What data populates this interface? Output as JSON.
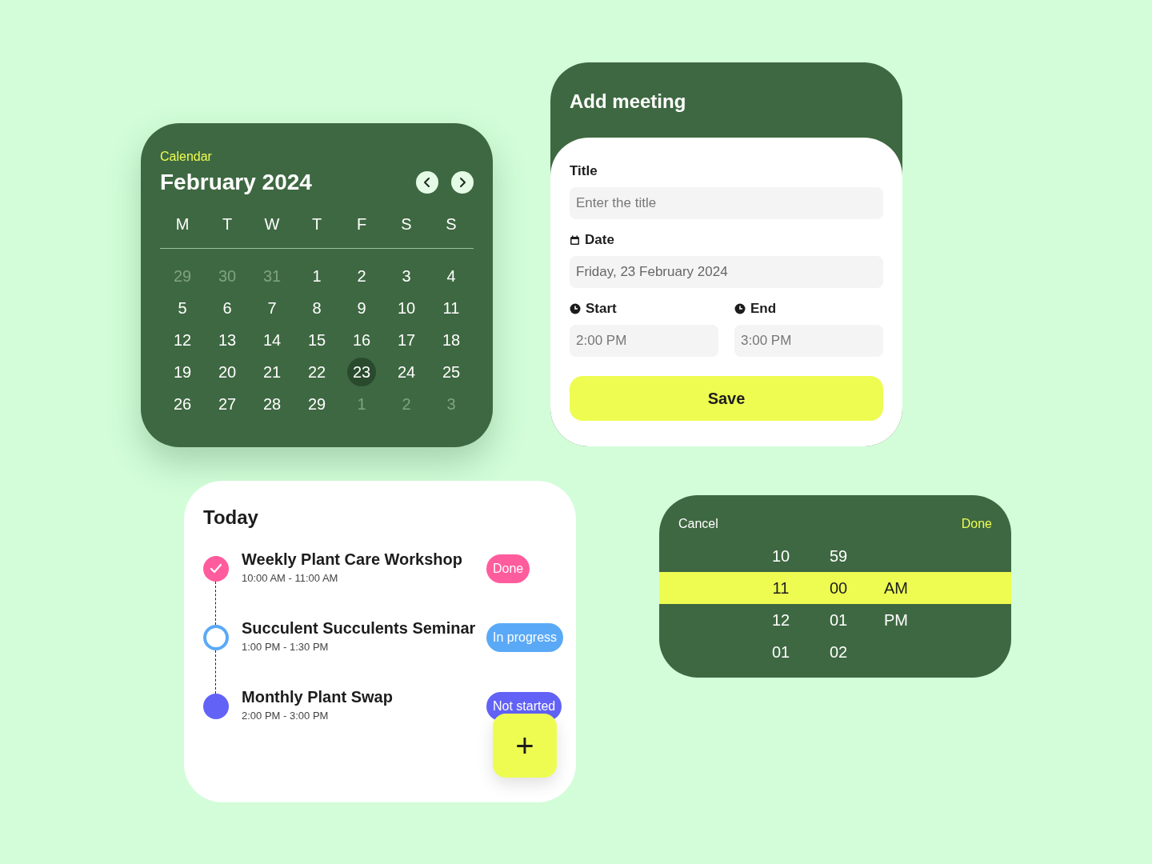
{
  "calendar": {
    "label": "Calendar",
    "month": "February 2024",
    "weekdays": [
      "M",
      "T",
      "W",
      "T",
      "F",
      "S",
      "S"
    ],
    "weeks": [
      [
        {
          "day": "29",
          "muted": true,
          "selected": false
        },
        {
          "day": "30",
          "muted": true,
          "selected": false
        },
        {
          "day": "31",
          "muted": true,
          "selected": false
        },
        {
          "day": "1",
          "muted": false,
          "selected": false
        },
        {
          "day": "2",
          "muted": false,
          "selected": false
        },
        {
          "day": "3",
          "muted": false,
          "selected": false
        },
        {
          "day": "4",
          "muted": false,
          "selected": false
        }
      ],
      [
        {
          "day": "5",
          "muted": false,
          "selected": false
        },
        {
          "day": "6",
          "muted": false,
          "selected": false
        },
        {
          "day": "7",
          "muted": false,
          "selected": false
        },
        {
          "day": "8",
          "muted": false,
          "selected": false
        },
        {
          "day": "9",
          "muted": false,
          "selected": false
        },
        {
          "day": "10",
          "muted": false,
          "selected": false
        },
        {
          "day": "11",
          "muted": false,
          "selected": false
        }
      ],
      [
        {
          "day": "12",
          "muted": false,
          "selected": false
        },
        {
          "day": "13",
          "muted": false,
          "selected": false
        },
        {
          "day": "14",
          "muted": false,
          "selected": false
        },
        {
          "day": "15",
          "muted": false,
          "selected": false
        },
        {
          "day": "16",
          "muted": false,
          "selected": false
        },
        {
          "day": "17",
          "muted": false,
          "selected": false
        },
        {
          "day": "18",
          "muted": false,
          "selected": false
        }
      ],
      [
        {
          "day": "19",
          "muted": false,
          "selected": false
        },
        {
          "day": "20",
          "muted": false,
          "selected": false
        },
        {
          "day": "21",
          "muted": false,
          "selected": false
        },
        {
          "day": "22",
          "muted": false,
          "selected": false
        },
        {
          "day": "23",
          "muted": false,
          "selected": true
        },
        {
          "day": "24",
          "muted": false,
          "selected": false
        },
        {
          "day": "25",
          "muted": false,
          "selected": false
        }
      ],
      [
        {
          "day": "26",
          "muted": false,
          "selected": false
        },
        {
          "day": "27",
          "muted": false,
          "selected": false
        },
        {
          "day": "28",
          "muted": false,
          "selected": false
        },
        {
          "day": "29",
          "muted": false,
          "selected": false
        },
        {
          "day": "1",
          "muted": true,
          "selected": false
        },
        {
          "day": "2",
          "muted": true,
          "selected": false
        },
        {
          "day": "3",
          "muted": true,
          "selected": false
        }
      ]
    ]
  },
  "meeting": {
    "title": "Add meeting",
    "fields": [
      {
        "label": "Title",
        "placeholder": "Enter the title"
      },
      {
        "label": "Date",
        "value": "Friday, 23 February 2024"
      }
    ],
    "start": {
      "label": "Start",
      "value": "2:00 PM"
    },
    "end": {
      "label": "End",
      "value": "3:00 PM"
    },
    "save": "Save"
  },
  "today": {
    "title": "Today",
    "events": [
      {
        "name": "Weekly Plant Care Workshop",
        "time": "10:00 AM - 11:00 AM",
        "status": "Done",
        "kind": "done",
        "color": "#ff5c9d"
      },
      {
        "name": "Succulent Succulents Seminar",
        "time": "1:00 PM - 1:30 PM",
        "status": "In progress",
        "kind": "in_progress",
        "color": "#5aa9f7"
      },
      {
        "name": "Monthly Plant Swap",
        "time": "2:00 PM - 3:00 PM",
        "status": "Not started",
        "kind": "not_started",
        "color": "#6262f7"
      }
    ],
    "add": "+"
  },
  "time_picker": {
    "cancel": "Cancel",
    "done": "Done",
    "rows": [
      {
        "cells": [
          "10",
          "59",
          null
        ],
        "selected": false
      },
      {
        "cells": [
          "11",
          "00",
          "AM"
        ],
        "selected": true
      },
      {
        "cells": [
          "12",
          "01",
          "PM"
        ],
        "selected": false
      },
      {
        "cells": [
          "01",
          "02",
          null
        ],
        "selected": false
      }
    ]
  }
}
